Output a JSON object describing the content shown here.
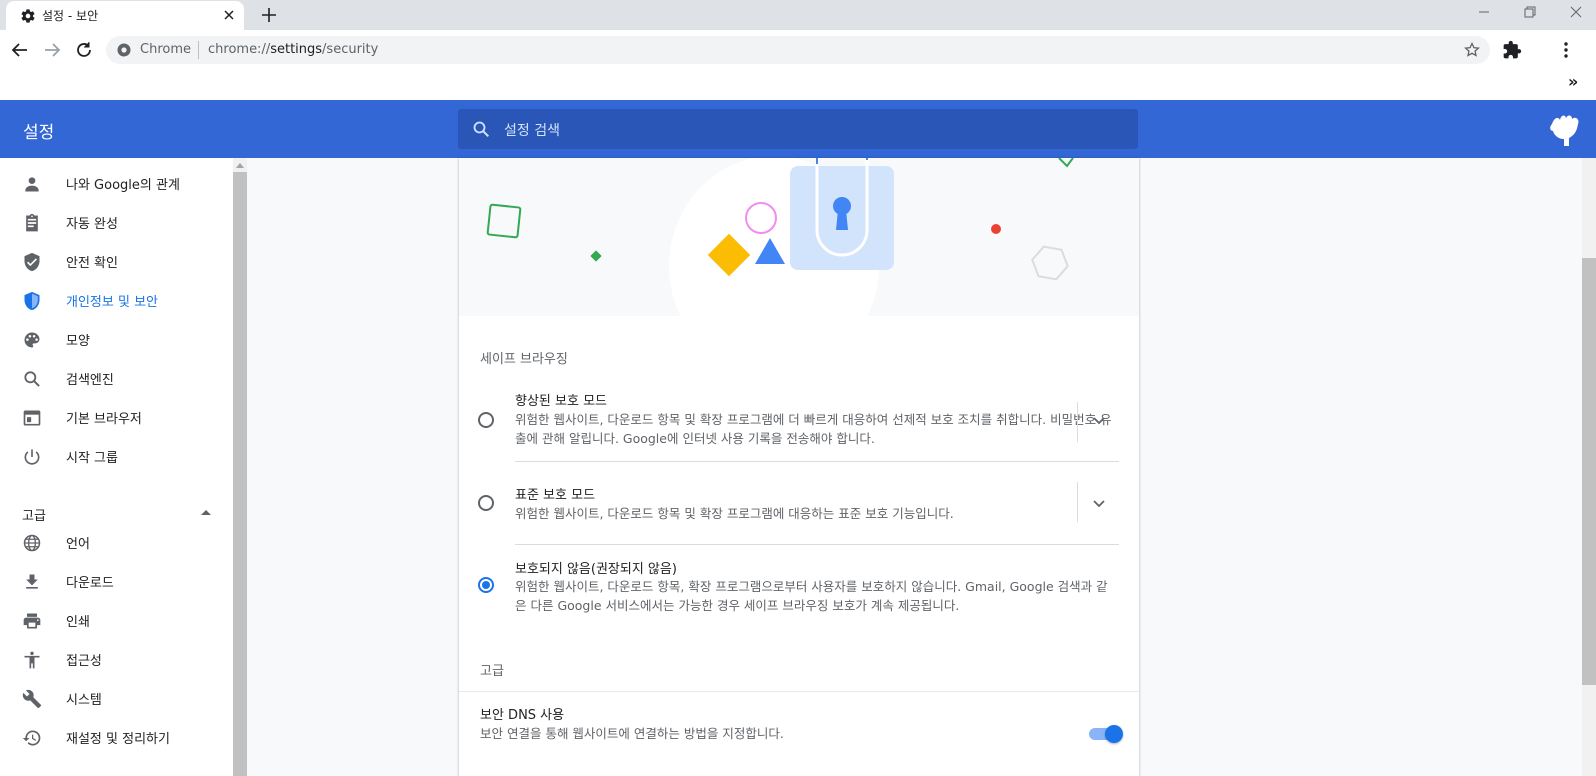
{
  "tab": {
    "title": "설정 - 보안"
  },
  "omnibox": {
    "scheme": "Chrome",
    "url_prefix": "chrome://",
    "url_host": "settings",
    "url_path": "/security"
  },
  "bookmarks": {
    "overflow": "»"
  },
  "header": {
    "title": "설정",
    "search_placeholder": "설정 검색"
  },
  "sidebar": {
    "items": [
      {
        "label": "나와 Google의 관계",
        "icon": "person-icon"
      },
      {
        "label": "자동 완성",
        "icon": "clipboard-icon"
      },
      {
        "label": "안전 확인",
        "icon": "shield-check-icon"
      },
      {
        "label": "개인정보 및 보안",
        "icon": "shield-icon"
      },
      {
        "label": "모양",
        "icon": "palette-icon"
      },
      {
        "label": "검색엔진",
        "icon": "search-icon"
      },
      {
        "label": "기본 브라우저",
        "icon": "browser-icon"
      },
      {
        "label": "시작 그룹",
        "icon": "power-icon"
      }
    ],
    "advanced_label": "고급",
    "advanced_items": [
      {
        "label": "언어",
        "icon": "globe-icon"
      },
      {
        "label": "다운로드",
        "icon": "download-icon"
      },
      {
        "label": "인쇄",
        "icon": "printer-icon"
      },
      {
        "label": "접근성",
        "icon": "accessibility-icon"
      },
      {
        "label": "시스템",
        "icon": "wrench-icon"
      },
      {
        "label": "재설정 및 정리하기",
        "icon": "restore-icon"
      }
    ]
  },
  "safe_browsing": {
    "title": "세이프 브라우징",
    "options": [
      {
        "label": "향상된 보호 모드",
        "desc": "위험한 웹사이트, 다운로드 항목 및 확장 프로그램에 더 빠르게 대응하여 선제적 보호 조치를 취합니다. 비밀번호 유출에 관해 알립니다. Google에 인터넷 사용 기록을 전송해야 합니다.",
        "checked": false
      },
      {
        "label": "표준 보호 모드",
        "desc": "위험한 웹사이트, 다운로드 항목 및 확장 프로그램에 대응하는 표준 보호 기능입니다.",
        "checked": false
      },
      {
        "label": "보호되지 않음(권장되지 않음)",
        "desc": "위험한 웹사이트, 다운로드 항목, 확장 프로그램으로부터 사용자를 보호하지 않습니다. Gmail, Google 검색과 같은 다른 Google 서비스에서는 가능한 경우 세이프 브라우징 보호가 계속 제공됩니다.",
        "checked": true
      }
    ]
  },
  "advanced": {
    "title": "고급",
    "secure_dns": {
      "label": "보안 DNS 사용",
      "desc": "보안 연결을 통해 웹사이트에 연결하는 방법을 지정합니다.",
      "enabled": true
    }
  },
  "colors": {
    "accent": "#1a73e8",
    "header": "#3367d6",
    "search": "#2a56b8"
  }
}
